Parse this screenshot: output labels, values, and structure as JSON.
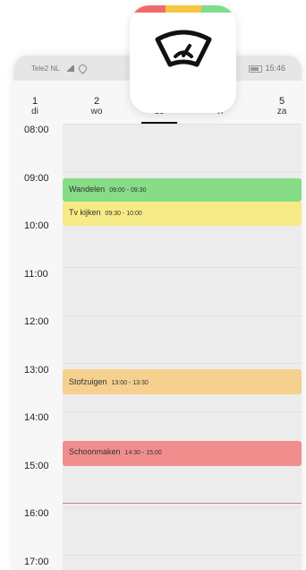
{
  "app_icon": {
    "icon": "speedometer-gauge-icon",
    "stripe_colors": [
      "#ef6b6b",
      "#f6c542",
      "#7fdc8a"
    ]
  },
  "status_bar": {
    "carrier": "Tele2 NL",
    "time": "15:46"
  },
  "days": [
    {
      "num": "1",
      "name": "di"
    },
    {
      "num": "2",
      "name": "wo"
    },
    {
      "num": "",
      "name": "do"
    },
    {
      "num": "",
      "name": "vr"
    },
    {
      "num": "5",
      "name": "za"
    }
  ],
  "selected_day": "do",
  "hours": [
    "08:00",
    "09:00",
    "10:00",
    "11:00",
    "12:00",
    "13:00",
    "14:00",
    "15:00",
    "16:00",
    "17:00"
  ],
  "events": [
    {
      "title": "Wandelen",
      "time": "09:00 - 09:30",
      "color": "#86dd86"
    },
    {
      "title": "Tv kijken",
      "time": "09:30 - 10:00",
      "color": "#f6eb86"
    },
    {
      "title": "Stofzuigen",
      "time": "13:00 - 13:30",
      "color": "#f5d08e"
    },
    {
      "title": "Schoonmaken",
      "time": "14:30 - 15:00",
      "color": "#f28d8d"
    }
  ],
  "now_line_color": "#d77a8a"
}
